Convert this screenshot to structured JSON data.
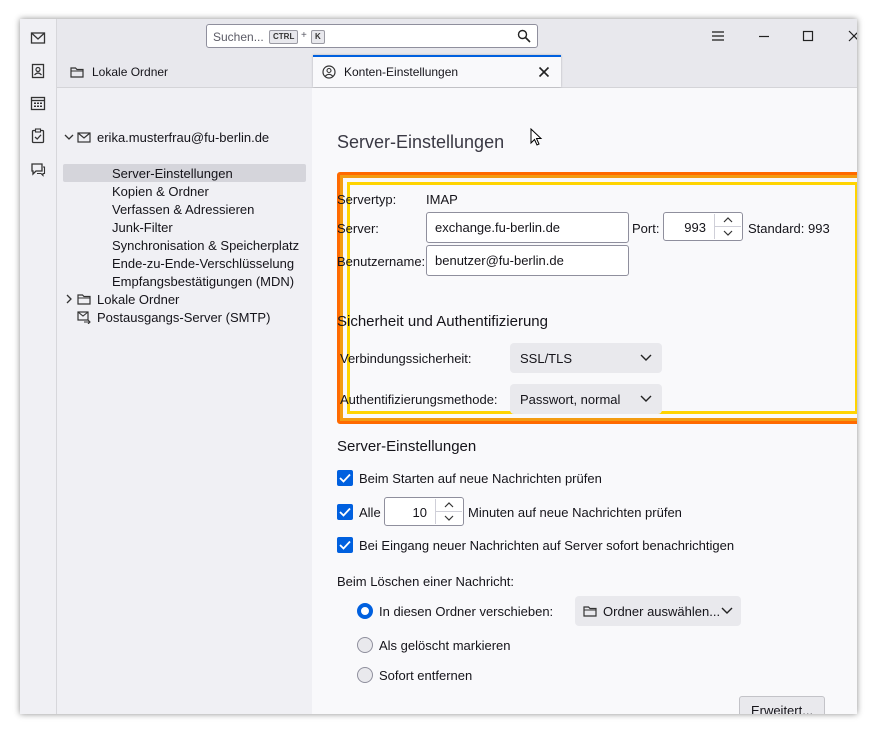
{
  "search": {
    "placeholder": "Suchen...",
    "shortcut_ctrl": "CTRL",
    "shortcut_plus": "+",
    "shortcut_key": "K"
  },
  "tabs": [
    {
      "label": "Lokale Ordner",
      "icon": "folder-icon",
      "active": false
    },
    {
      "label": "Konten-Einstellungen",
      "icon": "account-settings-icon",
      "active": true
    }
  ],
  "folder_tree": {
    "account": "erika.musterfrau@fu-berlin.de",
    "items": [
      {
        "label": "Server-Einstellungen",
        "selected": true
      },
      {
        "label": "Kopien & Ordner"
      },
      {
        "label": "Verfassen & Adressieren"
      },
      {
        "label": "Junk-Filter"
      },
      {
        "label": "Synchronisation & Speicherplatz"
      },
      {
        "label": "Ende-zu-Ende-Verschlüsselung"
      },
      {
        "label": "Empfangsbestätigungen (MDN)"
      }
    ],
    "local_folders": "Lokale Ordner",
    "smtp": "Postausgangs-Server (SMTP)"
  },
  "page": {
    "title": "Server-Einstellungen",
    "server_type_label": "Servertyp:",
    "server_type_value": "IMAP",
    "server_label": "Server:",
    "server_value": "exchange.fu-berlin.de",
    "port_label": "Port:",
    "port_value": "993",
    "port_default": "Standard: 993",
    "username_label": "Benutzername:",
    "username_value": "benutzer@fu-berlin.de",
    "security_heading": "Sicherheit und Authentifizierung",
    "conn_security_label": "Verbindungssicherheit:",
    "conn_security_value": "SSL/TLS",
    "auth_method_label": "Authentifizierungsmethode:",
    "auth_method_value": "Passwort, normal",
    "server_settings_heading": "Server-Einstellungen",
    "check_on_start": "Beim Starten auf neue Nachrichten prüfen",
    "check_every_prefix": "Alle",
    "check_every_value": "10",
    "check_every_suffix": "Minuten auf neue Nachrichten prüfen",
    "notify_immediately": "Bei Eingang neuer Nachrichten auf Server sofort benachrichtigen",
    "delete_label": "Beim Löschen einer Nachricht:",
    "radio_move": "In diesen Ordner verschieben:",
    "folder_select": "Ordner auswählen...",
    "radio_mark": "Als gelöscht markieren",
    "radio_remove": "Sofort entfernen",
    "advanced_button": "Erweitert..."
  },
  "colors": {
    "accent": "#0060df",
    "highlight_outer": "#ff6a00",
    "highlight_inner": "#ffd400"
  }
}
